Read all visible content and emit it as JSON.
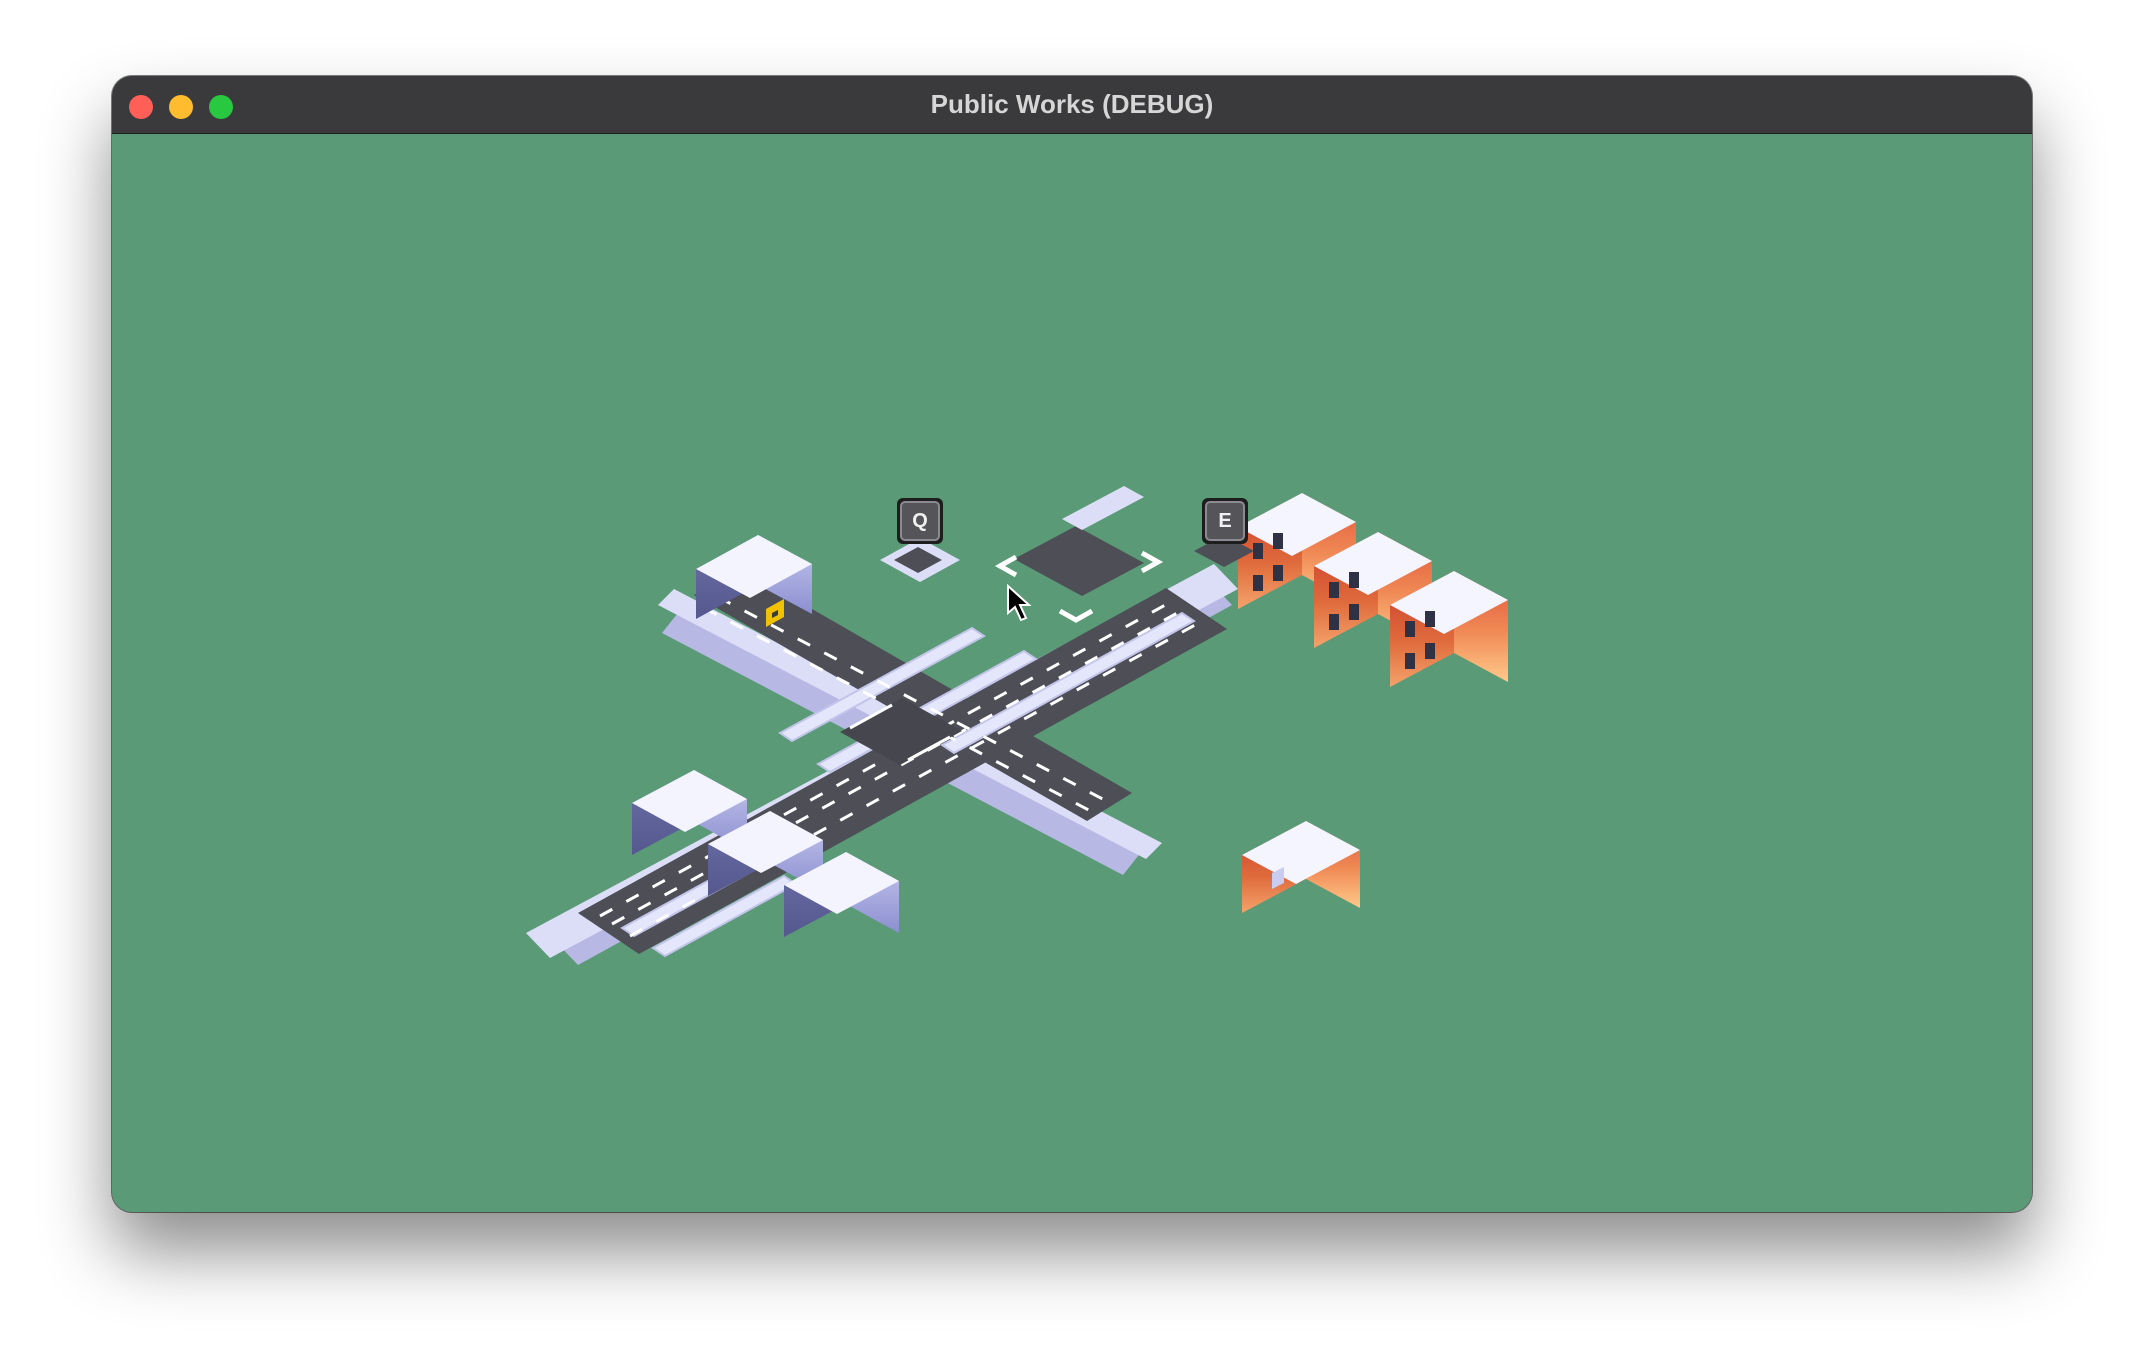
{
  "window": {
    "title": "Public Works (DEBUG)"
  },
  "colors": {
    "background": "#5a9a77",
    "titlebar": "#3a3a3c",
    "close": "#ff5f57",
    "minimize": "#febc2e",
    "maximize": "#28c840",
    "road": "#4d4e56",
    "lane_marking": "#ffffff",
    "curb": "#d9dbf5",
    "brick": "#e0523a",
    "garage_door": "#f2c200"
  },
  "hud": {
    "rotate_left_key": "Q",
    "rotate_right_key": "E"
  }
}
